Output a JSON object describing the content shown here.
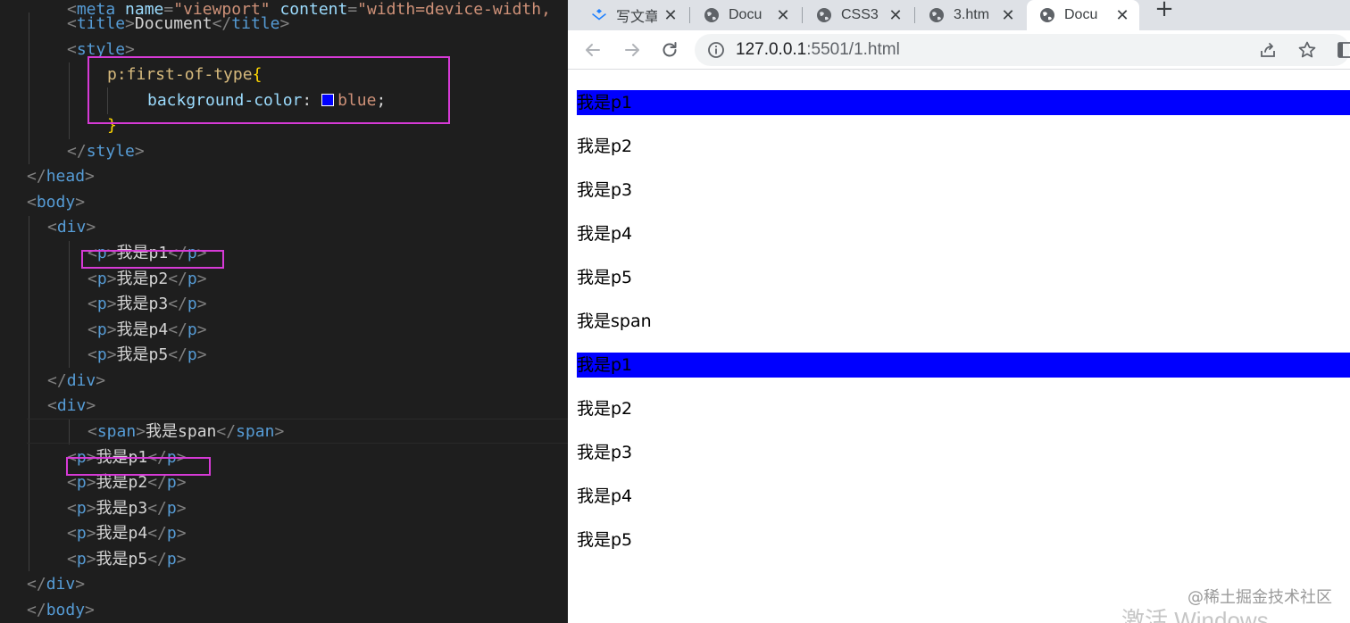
{
  "editor": {
    "lines": [
      {
        "id": "meta",
        "tokens": [
          [
            "punc",
            "<"
          ],
          [
            "tag",
            "meta"
          ],
          [
            "text",
            " "
          ],
          [
            "attr",
            "name"
          ],
          [
            "punc",
            "="
          ],
          [
            "str",
            "\"viewport\""
          ],
          [
            "text",
            " "
          ],
          [
            "attr",
            "content"
          ],
          [
            "punc",
            "="
          ],
          [
            "str",
            "\"width=device-width, "
          ]
        ]
      },
      {
        "id": "title",
        "tokens": [
          [
            "punc",
            "<"
          ],
          [
            "tag",
            "title"
          ],
          [
            "punc",
            ">"
          ],
          [
            "text",
            "Document"
          ],
          [
            "punc",
            "</"
          ],
          [
            "tag",
            "title"
          ],
          [
            "punc",
            ">"
          ]
        ]
      },
      {
        "id": "style-open",
        "tokens": [
          [
            "punc",
            "<"
          ],
          [
            "tag",
            "style"
          ],
          [
            "punc",
            ">"
          ]
        ]
      },
      {
        "id": "selector",
        "tokens": [
          [
            "sel",
            "p:first-of-type"
          ],
          [
            "brace",
            "{"
          ]
        ]
      },
      {
        "id": "decl",
        "tokens": [
          [
            "prop",
            "background-color"
          ],
          [
            "text",
            ": "
          ],
          [
            "swatch",
            ""
          ],
          [
            "val",
            "blue"
          ],
          [
            "text",
            ";"
          ]
        ]
      },
      {
        "id": "brace-close",
        "tokens": [
          [
            "brace",
            "}"
          ]
        ]
      },
      {
        "id": "style-close",
        "tokens": [
          [
            "punc",
            "</"
          ],
          [
            "tag",
            "style"
          ],
          [
            "punc",
            ">"
          ]
        ]
      },
      {
        "id": "head-close",
        "tokens": [
          [
            "punc",
            "</"
          ],
          [
            "tag",
            "head"
          ],
          [
            "punc",
            ">"
          ]
        ]
      },
      {
        "id": "body-open",
        "tokens": [
          [
            "punc",
            "<"
          ],
          [
            "tag",
            "body"
          ],
          [
            "punc",
            ">"
          ]
        ]
      },
      {
        "id": "div1-open",
        "tokens": [
          [
            "punc",
            "<"
          ],
          [
            "tag",
            "div"
          ],
          [
            "punc",
            ">"
          ]
        ]
      },
      {
        "id": "d1p1",
        "tokens": [
          [
            "punc",
            "<"
          ],
          [
            "tag",
            "p"
          ],
          [
            "punc",
            ">"
          ],
          [
            "text",
            "我是p1"
          ],
          [
            "punc",
            "</"
          ],
          [
            "tag",
            "p"
          ],
          [
            "punc",
            ">"
          ]
        ]
      },
      {
        "id": "d1p2",
        "tokens": [
          [
            "punc",
            "<"
          ],
          [
            "tag",
            "p"
          ],
          [
            "punc",
            ">"
          ],
          [
            "text",
            "我是p2"
          ],
          [
            "punc",
            "</"
          ],
          [
            "tag",
            "p"
          ],
          [
            "punc",
            ">"
          ]
        ]
      },
      {
        "id": "d1p3",
        "tokens": [
          [
            "punc",
            "<"
          ],
          [
            "tag",
            "p"
          ],
          [
            "punc",
            ">"
          ],
          [
            "text",
            "我是p3"
          ],
          [
            "punc",
            "</"
          ],
          [
            "tag",
            "p"
          ],
          [
            "punc",
            ">"
          ]
        ]
      },
      {
        "id": "d1p4",
        "tokens": [
          [
            "punc",
            "<"
          ],
          [
            "tag",
            "p"
          ],
          [
            "punc",
            ">"
          ],
          [
            "text",
            "我是p4"
          ],
          [
            "punc",
            "</"
          ],
          [
            "tag",
            "p"
          ],
          [
            "punc",
            ">"
          ]
        ]
      },
      {
        "id": "d1p5",
        "tokens": [
          [
            "punc",
            "<"
          ],
          [
            "tag",
            "p"
          ],
          [
            "punc",
            ">"
          ],
          [
            "text",
            "我是p5"
          ],
          [
            "punc",
            "</"
          ],
          [
            "tag",
            "p"
          ],
          [
            "punc",
            ">"
          ]
        ]
      },
      {
        "id": "div1-close",
        "tokens": [
          [
            "punc",
            "</"
          ],
          [
            "tag",
            "div"
          ],
          [
            "punc",
            ">"
          ]
        ]
      },
      {
        "id": "div2-open",
        "tokens": [
          [
            "punc",
            "<"
          ],
          [
            "tag",
            "div"
          ],
          [
            "punc",
            ">"
          ]
        ]
      },
      {
        "id": "span",
        "tokens": [
          [
            "punc",
            "<"
          ],
          [
            "tag",
            "span"
          ],
          [
            "punc",
            ">"
          ],
          [
            "text",
            "我是span"
          ],
          [
            "punc",
            "</"
          ],
          [
            "tag",
            "span"
          ],
          [
            "punc",
            ">"
          ]
        ]
      },
      {
        "id": "d2p1",
        "tokens": [
          [
            "punc",
            "<"
          ],
          [
            "tag",
            "p"
          ],
          [
            "punc",
            ">"
          ],
          [
            "text",
            "我是p1"
          ],
          [
            "punc",
            "</"
          ],
          [
            "tag",
            "p"
          ],
          [
            "punc",
            ">"
          ]
        ]
      },
      {
        "id": "d2p2",
        "tokens": [
          [
            "punc",
            "<"
          ],
          [
            "tag",
            "p"
          ],
          [
            "punc",
            ">"
          ],
          [
            "text",
            "我是p2"
          ],
          [
            "punc",
            "</"
          ],
          [
            "tag",
            "p"
          ],
          [
            "punc",
            ">"
          ]
        ]
      },
      {
        "id": "d2p3",
        "tokens": [
          [
            "punc",
            "<"
          ],
          [
            "tag",
            "p"
          ],
          [
            "punc",
            ">"
          ],
          [
            "text",
            "我是p3"
          ],
          [
            "punc",
            "</"
          ],
          [
            "tag",
            "p"
          ],
          [
            "punc",
            ">"
          ]
        ]
      },
      {
        "id": "d2p4",
        "tokens": [
          [
            "punc",
            "<"
          ],
          [
            "tag",
            "p"
          ],
          [
            "punc",
            ">"
          ],
          [
            "text",
            "我是p4"
          ],
          [
            "punc",
            "</"
          ],
          [
            "tag",
            "p"
          ],
          [
            "punc",
            ">"
          ]
        ]
      },
      {
        "id": "d2p5",
        "tokens": [
          [
            "punc",
            "<"
          ],
          [
            "tag",
            "p"
          ],
          [
            "punc",
            ">"
          ],
          [
            "text",
            "我是p5"
          ],
          [
            "punc",
            "</"
          ],
          [
            "tag",
            "p"
          ],
          [
            "punc",
            ">"
          ]
        ]
      },
      {
        "id": "div2-close",
        "tokens": [
          [
            "punc",
            "</"
          ],
          [
            "tag",
            "div"
          ],
          [
            "punc",
            ">"
          ]
        ]
      },
      {
        "id": "body-close",
        "tokens": [
          [
            "punc",
            "</"
          ],
          [
            "tag",
            "body"
          ],
          [
            "punc",
            ">"
          ]
        ]
      }
    ]
  },
  "browser": {
    "tabs": [
      {
        "title": "写文章",
        "icon": "juejin-icon",
        "active": false
      },
      {
        "title": "Docu",
        "icon": "globe-icon",
        "active": false
      },
      {
        "title": "CSS3",
        "icon": "globe-icon",
        "active": false
      },
      {
        "title": "3.htm",
        "icon": "globe-icon",
        "active": false
      },
      {
        "title": "Docu",
        "icon": "globe-icon",
        "active": true
      }
    ],
    "new_tab_label": "+",
    "close_label": "✕",
    "url_host": "127.0.0.1",
    "url_rest": ":5501/1.html",
    "page": {
      "paragraphs": [
        "我是p1",
        "我是p2",
        "我是p3",
        "我是p4",
        "我是p5",
        "我是span",
        "我是p1",
        "我是p2",
        "我是p3",
        "我是p4",
        "我是p5"
      ],
      "highlighted_indices": [
        0,
        6
      ],
      "highlight_color": "#0000ff"
    },
    "watermark": "@稀土掘金技术社区",
    "activate_text": "激活 Windows"
  }
}
